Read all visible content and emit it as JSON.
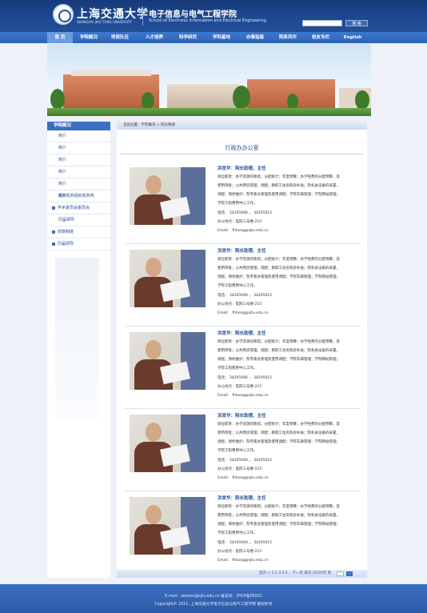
{
  "header": {
    "logo_cn": "上海交通大学",
    "logo_en": "SHANGHAI JIAO TONG UNIVERSITY",
    "school_cn": "电子信息与电气工程学院",
    "school_en": "School of Electronic Information and Electrical Engineering",
    "search_button": "搜 索",
    "search_placeholder": ""
  },
  "nav": {
    "items": [
      "首 页",
      "学院概况",
      "师资队伍",
      "人才培养",
      "科学研究",
      "学科基地",
      "办事指南",
      "院系风华",
      "校友专栏",
      "English"
    ]
  },
  "sidebar": {
    "heading": "学院概况",
    "items": [
      {
        "label": "简介",
        "has_box": false
      },
      {
        "label": "简介",
        "has_box": false
      },
      {
        "label": "简介",
        "has_box": false
      },
      {
        "label": "简介",
        "has_box": false
      },
      {
        "label": "简介",
        "has_box": false
      },
      {
        "label": "简介",
        "has_box": false
      },
      {
        "label": "组织机构组织机构构",
        "has_box": false
      },
      {
        "label": "学术委员会委员会",
        "has_box": true
      },
      {
        "label": "历届领导",
        "has_box": false
      },
      {
        "label": "规章制度",
        "has_box": true
      },
      {
        "label": "历届领导",
        "has_box": true
      }
    ]
  },
  "breadcrumb": "当前位置：学院概况 > 院长致辞",
  "section_title": "行政办办公室",
  "staff": {
    "name": "洪发华：院长助理、主任",
    "desc1": "岗位职责：办学资源的筹措，分配统计；年度预算；办学经费的分配预算，及",
    "desc2": "使用审批；公共用房管理，调配；教职工住房购房补贴；院机关设备的采置，",
    "desc3": "调配，保修维护；院专家办管理及使用调配；学院车辆管理；学院网站管理；",
    "desc4": "学院工程费用中心工作。",
    "phone": "电话： 34205006 ， 34205015",
    "office": "办公地点：电院三号楼-215",
    "email": "Email： fhhong@sjtu.edu.cn"
  },
  "pager": {
    "text": "首页 < 1 2 3 4 5... 下一页 末页 20/20页 到"
  },
  "footer": {
    "line1": "E-mail：seieem@sjtu.edu.cn 备案号：沪ICP备05021",
    "line2": "Copyright© 2011, 上海交通大学电子信息与电气工程学院 版权所有"
  }
}
